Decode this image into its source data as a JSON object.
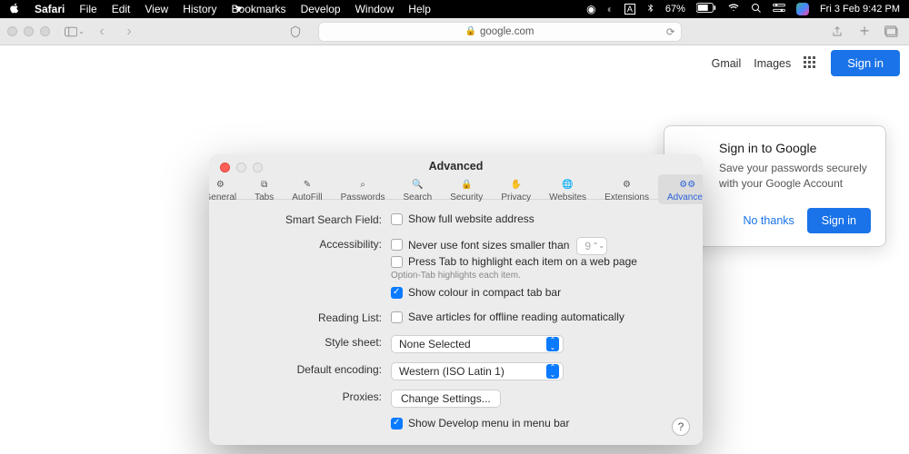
{
  "menubar": {
    "app": "Safari",
    "items": [
      "File",
      "Edit",
      "View",
      "History",
      "Bookmarks",
      "Develop",
      "Window",
      "Help"
    ],
    "battery": "67%",
    "clock": "Fri 3 Feb  9:42 PM"
  },
  "toolbar": {
    "url_host": "google.com"
  },
  "google": {
    "links": {
      "gmail": "Gmail",
      "images": "Images",
      "signin": "Sign in"
    },
    "popover": {
      "title": "Sign in to Google",
      "body": "Save your passwords securely with your Google Account",
      "nothanks": "No thanks",
      "signin": "Sign in"
    }
  },
  "prefs": {
    "title": "Advanced",
    "tabs": [
      "General",
      "Tabs",
      "AutoFill",
      "Passwords",
      "Search",
      "Security",
      "Privacy",
      "Websites",
      "Extensions",
      "Advanced"
    ],
    "smart_search_label": "Smart Search Field:",
    "smart_search_opt": "Show full website address",
    "accessibility_label": "Accessibility:",
    "acc_never_use": "Never use font sizes smaller than",
    "acc_font_size": "9",
    "acc_press_tab": "Press Tab to highlight each item on a web page",
    "acc_hint": "Option-Tab highlights each item.",
    "acc_colour": "Show colour in compact tab bar",
    "reading_list_label": "Reading List:",
    "reading_list_opt": "Save articles for offline reading automatically",
    "stylesheet_label": "Style sheet:",
    "stylesheet_value": "None Selected",
    "encoding_label": "Default encoding:",
    "encoding_value": "Western (ISO Latin 1)",
    "proxies_label": "Proxies:",
    "proxies_btn": "Change Settings...",
    "show_develop": "Show Develop menu in menu bar"
  }
}
